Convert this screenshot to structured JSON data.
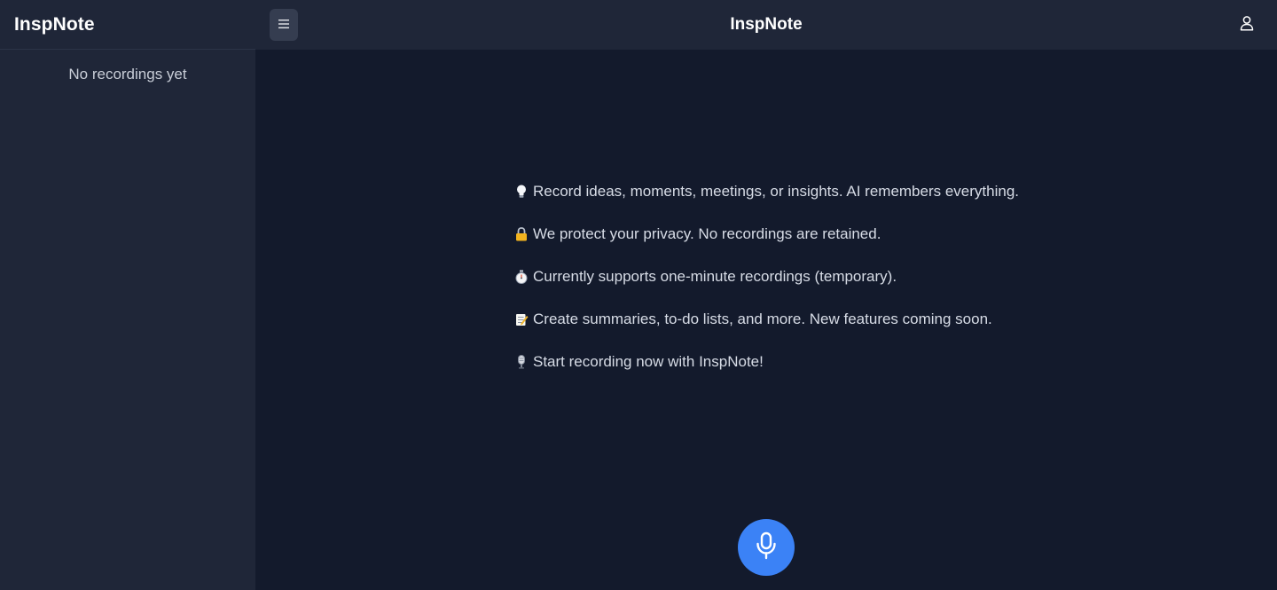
{
  "sidebar": {
    "title": "InspNote",
    "empty_text": "No recordings yet"
  },
  "header": {
    "title": "InspNote",
    "menu_icon": "menu-icon",
    "user_icon": "user-icon"
  },
  "intro": {
    "items": [
      {
        "icon": "lightbulb-icon",
        "text": "Record ideas, moments, meetings, or insights. AI remembers everything."
      },
      {
        "icon": "lock-icon",
        "text": "We protect your privacy. No recordings are retained."
      },
      {
        "icon": "stopwatch-icon",
        "text": "Currently supports one-minute recordings (temporary)."
      },
      {
        "icon": "memo-icon",
        "text": "Create summaries, to-do lists, and more. New features coming soon."
      },
      {
        "icon": "microphone-emoji-icon",
        "text": "Start recording now with InspNote!"
      }
    ]
  },
  "record_button": {
    "icon": "microphone-icon"
  },
  "colors": {
    "app_background": "#131a2c",
    "sidebar_background": "#1f2638",
    "menu_button_background": "#353d50",
    "accent": "#3b82f6",
    "text": "#d7dce6",
    "title_text": "#ffffff"
  }
}
